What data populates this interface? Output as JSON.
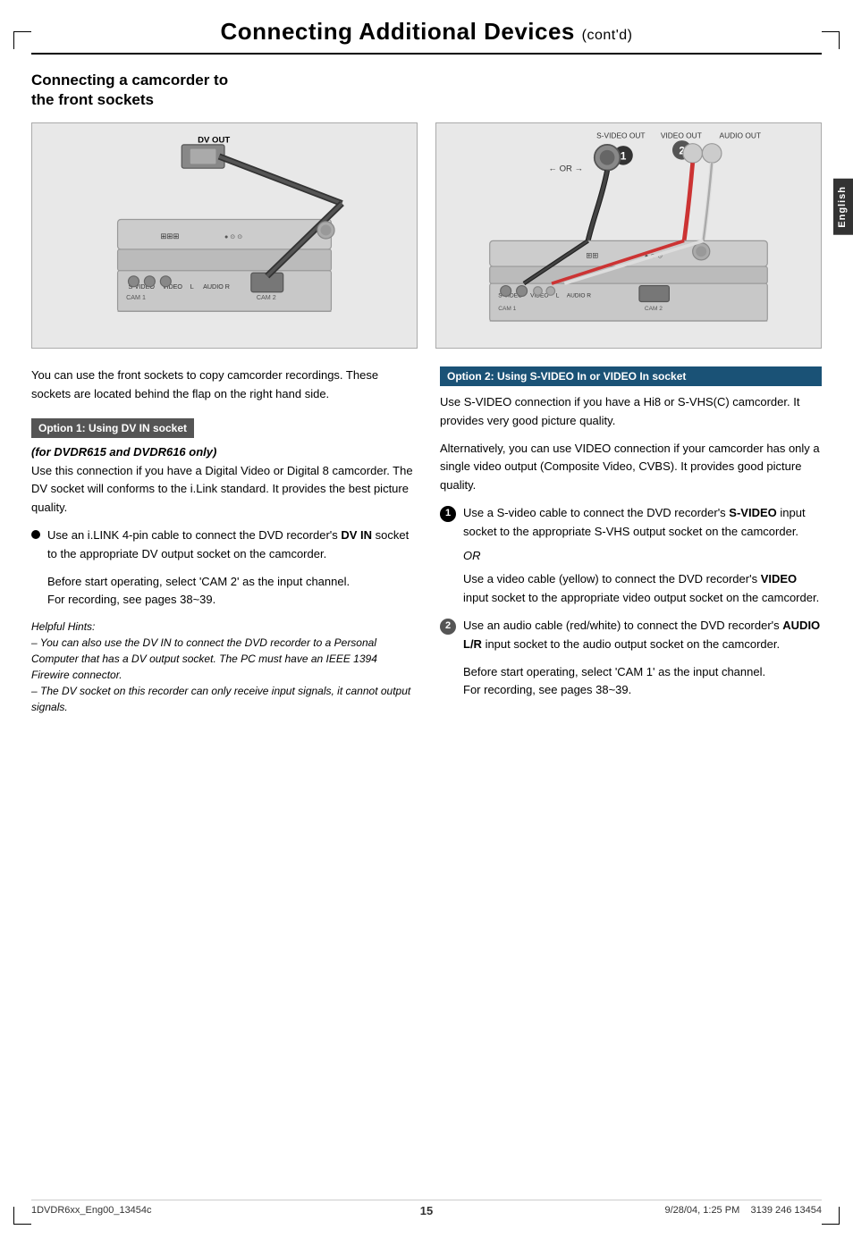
{
  "header": {
    "title": "Connecting Additional Devices",
    "subtitle": "(cont'd)"
  },
  "section": {
    "title_line1": "Connecting a camcorder to",
    "title_line2": "the front sockets"
  },
  "intro": {
    "text": "You can use the front sockets to copy camcorder recordings.  These sockets are located behind the flap on the right hand side."
  },
  "option1": {
    "label": "Option 1: Using DV IN socket",
    "subheading": "(for DVDR615 and DVDR616 only)",
    "body1": "Use this connection if you have a Digital Video or Digital 8 camcorder. The DV socket will conforms to the i.Link standard.  It provides the best picture quality.",
    "bullet1": "Use an i.LINK 4-pin cable to connect the DVD recorder's ",
    "bullet1_bold": "DV IN",
    "bullet1_cont": " socket to the appropriate DV output socket on the camcorder.",
    "before_text": "Before start operating, select 'CAM 2' as the input channel.",
    "recording_text": "For recording, see pages 38~39.",
    "helpful_hints_title": "Helpful Hints:",
    "hint1": "–  You can also use the DV IN to connect the DVD recorder to a Personal Computer that has a DV output socket. The PC must have an IEEE 1394 Firewire connector.",
    "hint2": "–  The DV socket on this recorder can only receive input signals, it cannot output signals."
  },
  "option2": {
    "label": "Option 2: Using S-VIDEO In or VIDEO In socket",
    "body1": "Use S-VIDEO connection if you have a Hi8 or S-VHS(C) camcorder.  It provides very good picture quality.",
    "body2": "Alternatively, you can use VIDEO connection if your camcorder has only a single video output (Composite Video, CVBS).  It provides good picture quality.",
    "bullet1_pre": "Use a S-video cable to connect the DVD recorder's ",
    "bullet1_bold": "S-VIDEO",
    "bullet1_cont": " input socket to the appropriate S-VHS output socket on the camcorder.",
    "or_text": "OR",
    "bullet1b": "Use a video cable (yellow) to connect the DVD recorder's ",
    "bullet1b_bold": "VIDEO",
    "bullet1b_cont": " input socket to the appropriate video output socket on the camcorder.",
    "bullet2_pre": "Use an audio cable (red/white) to connect the DVD recorder's ",
    "bullet2_bold": "AUDIO L/R",
    "bullet2_cont": " input socket to the audio output socket on the camcorder.",
    "before_text": "Before start operating, select 'CAM 1' as the input channel.",
    "recording_text": "For recording, see pages 38~39."
  },
  "footer": {
    "left": "1DVDR6xx_Eng00_13454c",
    "center": "15",
    "right_date": "9/28/04, 1:25 PM",
    "right_code": "3139 246 13454"
  },
  "side_tab": "English"
}
